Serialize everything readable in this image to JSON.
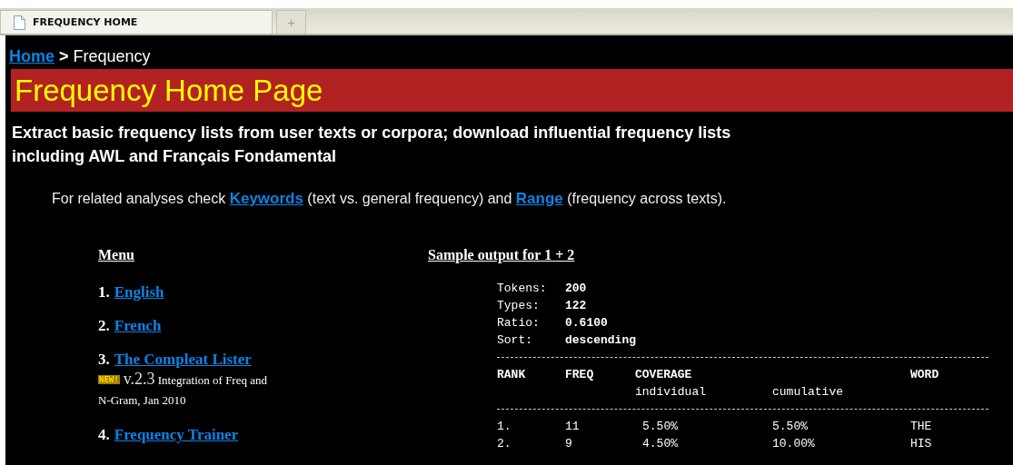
{
  "browser_tabs": [
    {
      "label": "FREQUENCY HOME",
      "kind": "page",
      "selected": true
    },
    {
      "label": "+",
      "kind": "new",
      "selected": false
    }
  ],
  "breadcrumb": {
    "link": "Home",
    "separator": ">",
    "current": "Frequency"
  },
  "title": "Frequency Home Page",
  "description": "Extract basic frequency lists from user texts or corpora; download influential frequency lists including AWL and Français Fondamental",
  "related": [
    {
      "kind": "text",
      "text": "For related analyses check "
    },
    {
      "kind": "link",
      "text": "Keywords"
    },
    {
      "kind": "text",
      "text": " (text vs. general frequency) and "
    },
    {
      "kind": "link",
      "text": "Range"
    },
    {
      "kind": "text",
      "text": " (frequency across texts)."
    }
  ],
  "menu": {
    "heading": "Menu",
    "items": [
      {
        "number": "1.",
        "link": "English"
      },
      {
        "number": "2.",
        "link": "French"
      },
      {
        "number": "3.",
        "link": "The Compleat Lister",
        "badge": "NEW!",
        "version": "v.2.3",
        "note": [
          "Integration of Freq and",
          "N-Gram, Jan 2010"
        ]
      },
      {
        "number": "4.",
        "link": "Frequency Trainer"
      }
    ]
  },
  "sample": {
    "heading": "Sample output for 1 + 2",
    "stats": [
      {
        "label": "Tokens:",
        "value": "200"
      },
      {
        "label": "Types:",
        "value": "122"
      },
      {
        "label": "Ratio:",
        "value": "0.6100"
      },
      {
        "label": "Sort:",
        "value": "descending"
      }
    ],
    "columns": [
      "RANK",
      "FREQ",
      "COVERAGE",
      "",
      "WORD"
    ],
    "subcolumns": [
      "",
      "",
      "individual",
      "cumulative",
      ""
    ],
    "rows": [
      [
        "1.",
        "11",
        "5.50%",
        "5.50%",
        "THE"
      ],
      [
        "2.",
        "9",
        "4.50%",
        "10.00%",
        "HIS"
      ]
    ]
  }
}
